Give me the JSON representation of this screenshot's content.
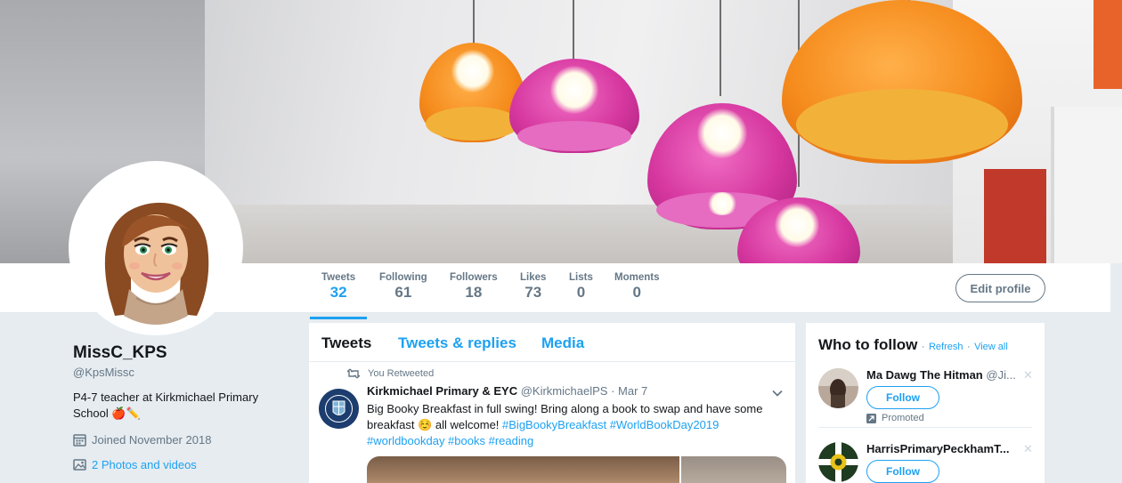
{
  "profile": {
    "display_name": "MissC_KPS",
    "handle": "@KpsMissc",
    "bio": "P4-7 teacher at Kirkmichael Primary School 🍎✏️",
    "joined": "Joined November 2018",
    "photos": "2 Photos and videos"
  },
  "nav": {
    "stats": [
      {
        "label": "Tweets",
        "value": "32"
      },
      {
        "label": "Following",
        "value": "61"
      },
      {
        "label": "Followers",
        "value": "18"
      },
      {
        "label": "Likes",
        "value": "73"
      },
      {
        "label": "Lists",
        "value": "0"
      },
      {
        "label": "Moments",
        "value": "0"
      }
    ],
    "edit_profile": "Edit profile"
  },
  "timeline": {
    "tabs": [
      {
        "label": "Tweets"
      },
      {
        "label": "Tweets & replies"
      },
      {
        "label": "Media"
      }
    ],
    "tweet": {
      "context": "You Retweeted",
      "full_name": "Kirkmichael Primary & EYC",
      "screen_name": "@KirkmichaelPS",
      "date": "· Mar 7",
      "text_plain": "Big Booky Breakfast in full swing! Bring along a book to swap and have some breakfast ☺️ all welcome! ",
      "hashtags_1": "#BigBookyBreakfast #WorldBookDay2019",
      "hashtags_2": "#worldbookday #books #reading"
    }
  },
  "who_to_follow": {
    "title": "Who to follow",
    "refresh": "Refresh",
    "view_all": "View all",
    "separator": "·",
    "accounts": [
      {
        "name": "Ma Dawg The Hitman",
        "handle": "@Ji...",
        "follow": "Follow",
        "promoted": "Promoted"
      },
      {
        "name": "HarrisPrimaryPeckhamT...",
        "handle": "",
        "follow": "Follow"
      }
    ]
  },
  "colors": {
    "accent": "#1da1f2",
    "background": "#e6ecf0",
    "secondary_text": "#657786"
  }
}
